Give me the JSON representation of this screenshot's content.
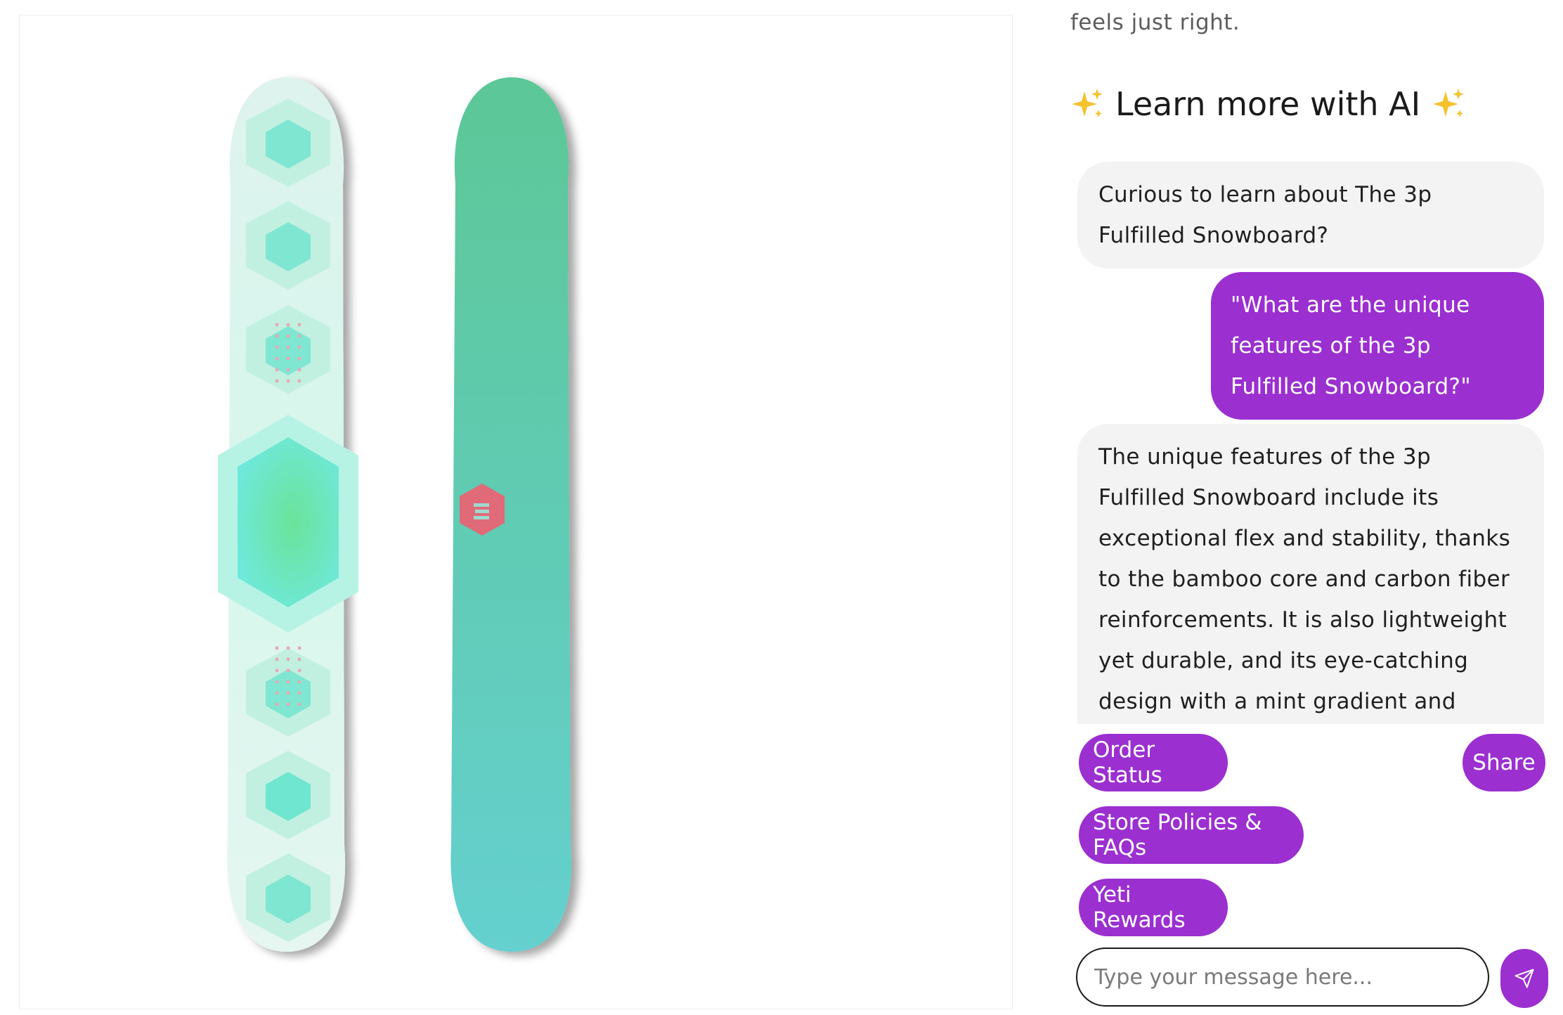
{
  "intro": {
    "text": "feels just right."
  },
  "ai_section": {
    "heading": "Learn more with AI",
    "sparkle_icon": "sparkles-icon"
  },
  "chat": {
    "messages": [
      {
        "role": "bot",
        "text": "Curious to learn about The 3p Fulfilled Snowboard?"
      },
      {
        "role": "user",
        "text": "\"What are the unique features of the 3p Fulfilled Snowboard?\""
      },
      {
        "role": "bot",
        "text": "The unique features of the 3p Fulfilled Snowboard include its exceptional flex and stability, thanks to the bamboo core and carbon fiber reinforcements. It is also lightweight yet durable, and its eye-catching design with a mint gradient and hexagonal patterns sets it apart on the"
      }
    ]
  },
  "quick_actions": {
    "order_status": "Order Status",
    "share": "Share",
    "policies": "Store Policies & FAQs",
    "rewards": "Yeti Rewards"
  },
  "composer": {
    "placeholder": "Type your message here...",
    "send_icon": "send-icon"
  },
  "colors": {
    "accent": "#9b2fd0",
    "bot_bubble": "#f3f3f3",
    "board_mint": "#6fe0c8",
    "board_base_top": "#5cc79a",
    "board_base_bottom": "#64d0cc",
    "logo_red": "#e06a78"
  }
}
